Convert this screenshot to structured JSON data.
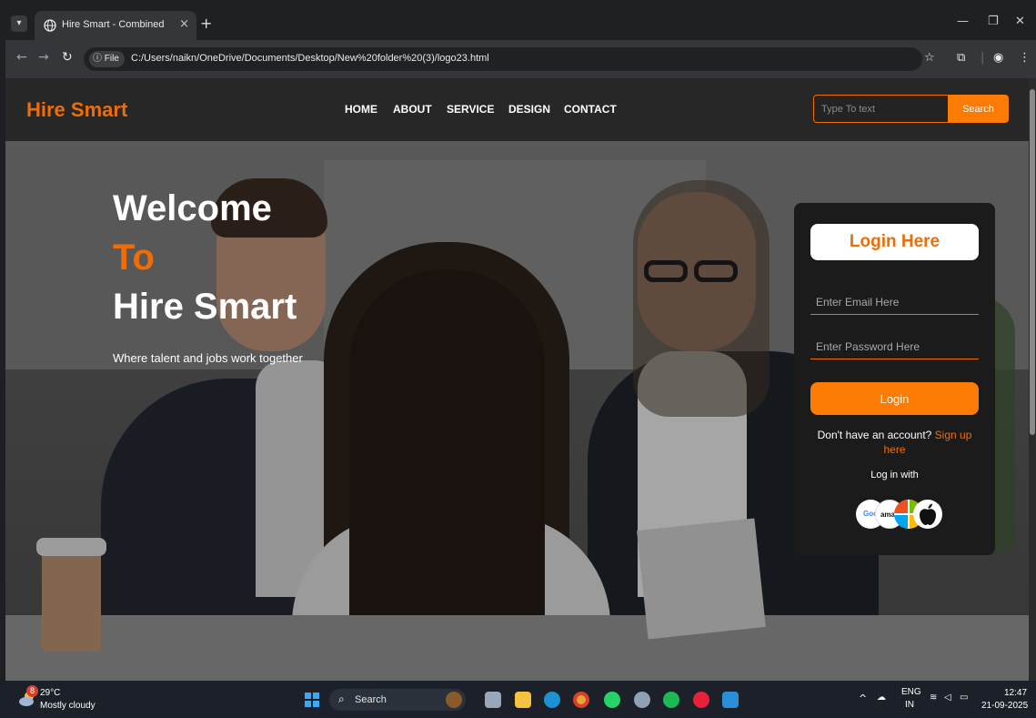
{
  "browser": {
    "tab_title": "Hire Smart - Combined",
    "tab_close": "×",
    "new_tab": "+",
    "url_chip": "File",
    "url": "C:/Users/naikn/OneDrive/Documents/Desktop/New%20folder%20(3)/logo23.html"
  },
  "site": {
    "brand": "Hire Smart",
    "nav": [
      "HOME",
      "ABOUT",
      "SERVICE",
      "DESIGN",
      "CONTACT"
    ],
    "search_placeholder": "Type To text",
    "search_button": "Search"
  },
  "hero": {
    "line1": "Welcome",
    "line2": "To",
    "line3": "Hire Smart",
    "tagline": "Where talent and jobs work together"
  },
  "login": {
    "title": "Login Here",
    "email_placeholder": "Enter Email Here",
    "password_placeholder": "Enter Password Here",
    "button": "Login",
    "no_account": "Don't have an account?",
    "signup_link": "Sign up here",
    "log_with": "Log in with",
    "social": [
      {
        "label": "Goo",
        "icon": "google-icon"
      },
      {
        "label": "amaz",
        "icon": "amazon-icon"
      },
      {
        "label": "",
        "icon": "microsoft-icon"
      },
      {
        "label": "",
        "icon": "apple-icon"
      }
    ]
  },
  "taskbar": {
    "weather_badge": "8",
    "temperature": "29°C",
    "weather": "Mostly cloudy",
    "search_label": "Search",
    "lang_top": "ENG",
    "lang_bottom": "IN",
    "time": "12:47",
    "date": "21-09-2025"
  },
  "colors": {
    "accent": "#f06d06",
    "button": "#fb7b04",
    "nav_bg": "#272727",
    "card_bg": "#1b1b1b"
  }
}
